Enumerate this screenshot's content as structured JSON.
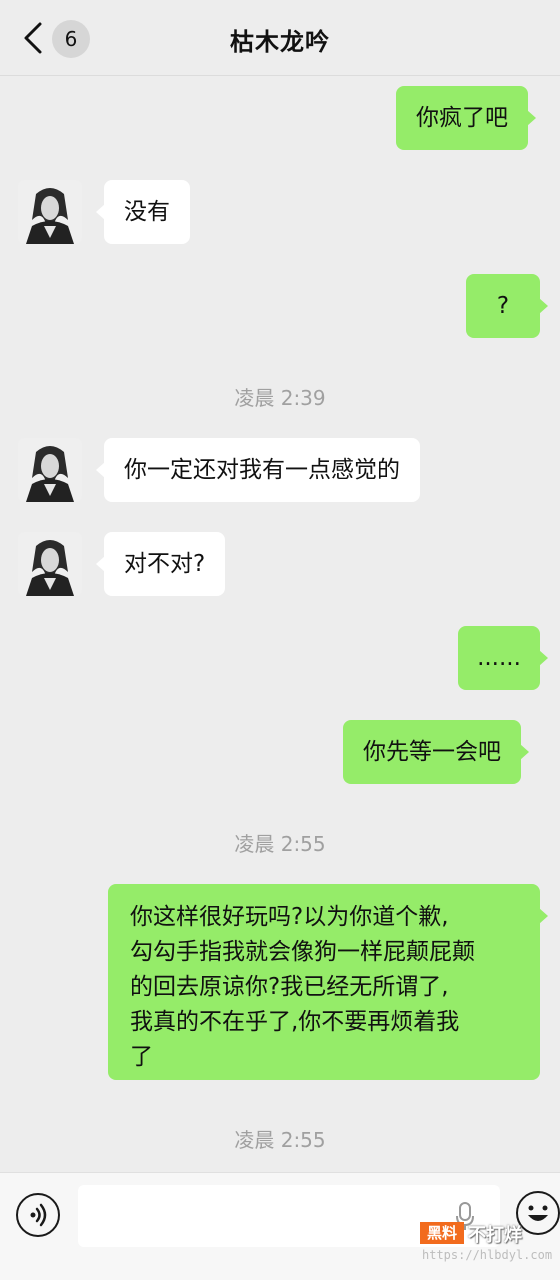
{
  "header": {
    "unread_count": "6",
    "title": "枯木龙吟"
  },
  "messages": [
    {
      "side": "out",
      "text": "你疯了吧"
    },
    {
      "side": "in",
      "text": "没有"
    },
    {
      "side": "out",
      "text": "?"
    },
    {
      "side": "time",
      "text": "凌晨 2:39"
    },
    {
      "side": "in",
      "text": "你一定还对我有一点感觉的"
    },
    {
      "side": "in",
      "text": "对不对?"
    },
    {
      "side": "out",
      "text": "......"
    },
    {
      "side": "out",
      "text": "你先等一会吧"
    },
    {
      "side": "time",
      "text": "凌晨 2:55"
    },
    {
      "side": "out",
      "lines": [
        "你这样很好玩吗?以为你道个歉,",
        "勾勾手指我就会像狗一样屁颠屁颠",
        "的回去原谅你?我已经无所谓了,",
        "我真的不在乎了,你不要再烦着我",
        "了"
      ]
    },
    {
      "side": "time",
      "text": "凌晨 2:55"
    }
  ],
  "watermark": {
    "box": "黑料",
    "text": "不打烊",
    "url": "https://hlbdyl.com"
  },
  "colors": {
    "background": "#ededed",
    "outgoing_bubble": "#95ec69",
    "incoming_bubble": "#ffffff"
  }
}
